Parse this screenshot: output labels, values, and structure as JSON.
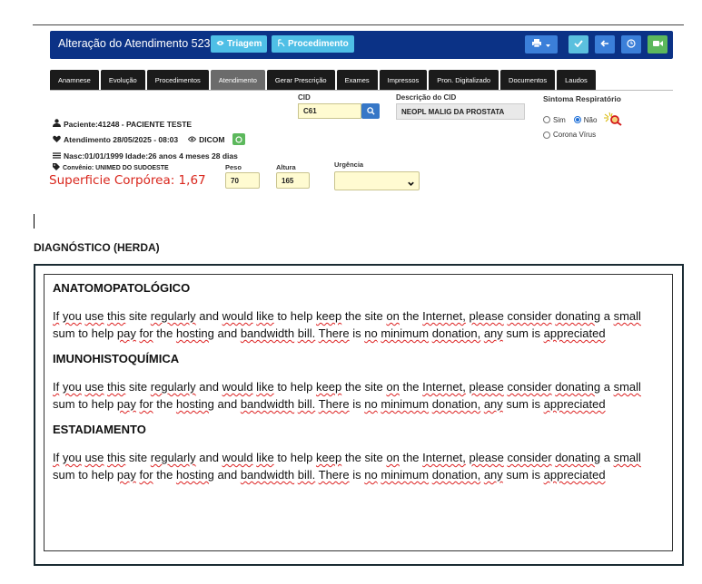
{
  "header": {
    "title": "Alteração do Atendimento 523821",
    "triagem_label": "Triagem",
    "procedimento_label": "Procedimento",
    "colors": {
      "bar": "#0b3286",
      "light_button": "#4fbfe6",
      "check": "#5bc0de",
      "video": "#5cb85c"
    }
  },
  "tabs": [
    {
      "label": "Anamnese"
    },
    {
      "label": "Evolução"
    },
    {
      "label": "Procedimentos"
    },
    {
      "label": "Atendimento",
      "active": true
    },
    {
      "label": "Gerar Prescrição"
    },
    {
      "label": "Exames"
    },
    {
      "label": "Impressos"
    },
    {
      "label": "Pron. Digitalizado"
    },
    {
      "label": "Documentos"
    },
    {
      "label": "Laudos"
    }
  ],
  "form": {
    "cid_label": "CID",
    "cid_value": "C61",
    "descricao_label": "Descrição do CID",
    "descricao_value": "NEOPL MALIG DA PROSTATA",
    "sintoma_label": "Sintoma Respiratório",
    "sim_label": "Sim",
    "nao_label": "Não",
    "selected": "Não",
    "corona_label": "Corona Vírus",
    "peso_label": "Peso",
    "peso_value": "70",
    "altura_label": "Altura",
    "altura_value": "165",
    "urgencia_label": "Urgência",
    "urgencia_value": ""
  },
  "patient": {
    "paciente": "Paciente:41248 - PACIENTE TESTE",
    "atendimento": "Atendimento 28/05/2025 - 08:03",
    "dicom": "DICOM",
    "nasc": "Nasc:01/01/1999 Idade:26 anos 4 meses 28 dias",
    "convenio": "Convênio: UNIMED DO SUDOESTE",
    "superficie": "Superficie Corpórea: 1,67"
  },
  "diagnostico": {
    "heading": "DIAGNÓSTICO (HERDA)",
    "sections": [
      {
        "title": "ANATOMOPATOLÓGICO",
        "body": "If you use this site regularly and would like to help keep the site on the Internet, please consider donating a small sum to help pay for the hosting and bandwidth bill. There is no minimum donation, any sum is appreciated"
      },
      {
        "title": "IMUNOHISTOQUÍMICA",
        "body": "If you use this site regularly and would like to help keep the site on the Internet, please consider donating a small sum to help pay for the hosting and bandwidth bill. There is no minimum donation, any sum is appreciated"
      },
      {
        "title": "ESTADIAMENTO",
        "body": "If you use this site regularly and would like to help keep the site on the Internet, please consider donating a small sum to help pay for the hosting and bandwidth bill. There is no minimum donation, any sum is appreciated"
      }
    ]
  }
}
